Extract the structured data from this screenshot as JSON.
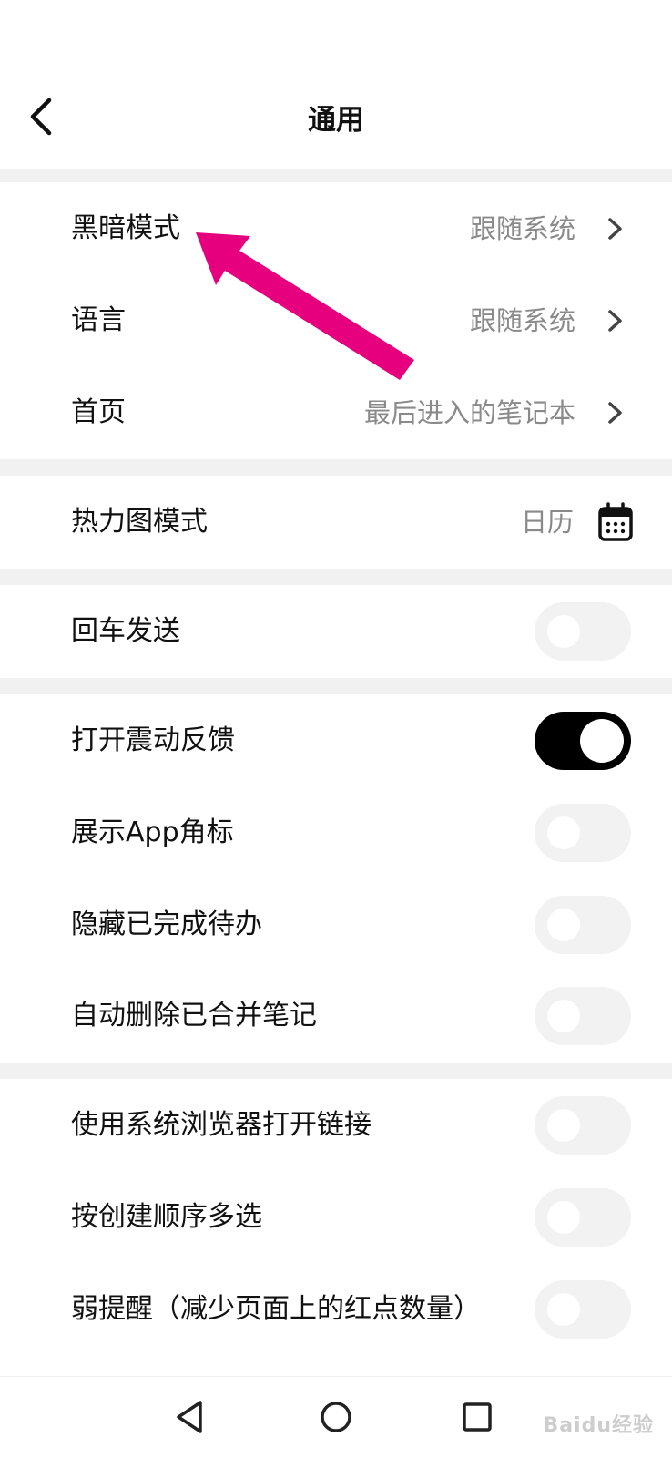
{
  "header": {
    "title": "通用"
  },
  "sections": [
    {
      "items": [
        {
          "label": "黑暗模式",
          "value": "跟随系统"
        },
        {
          "label": "语言",
          "value": "跟随系统"
        },
        {
          "label": "首页",
          "value": "最后进入的笔记本"
        }
      ]
    },
    {
      "items": [
        {
          "label": "热力图模式",
          "value": "日历"
        }
      ]
    },
    {
      "items": [
        {
          "label": "回车发送",
          "toggle": false
        }
      ]
    },
    {
      "items": [
        {
          "label": "打开震动反馈",
          "toggle": true
        },
        {
          "label": "展示App角标",
          "toggle": false
        },
        {
          "label": "隐藏已完成待办",
          "toggle": false
        },
        {
          "label": "自动删除已合并笔记",
          "toggle": false
        }
      ]
    },
    {
      "items": [
        {
          "label": "使用系统浏览器打开链接",
          "toggle": false
        },
        {
          "label": "按创建顺序多选",
          "toggle": false
        },
        {
          "label": "弱提醒（减少页面上的红点数量）",
          "toggle": false
        }
      ]
    }
  ],
  "watermark": "Baidu经验",
  "colors": {
    "accent_arrow": "#e6007e",
    "toggle_on": "#000000",
    "toggle_off": "#f2f2f2",
    "separator": "#f1f1f1",
    "value_text": "#8a8a8a"
  },
  "icons": {
    "back": "chevron-left-icon",
    "chevron": "chevron-right-icon",
    "calendar": "calendar-icon",
    "nav_back": "triangle-back-icon",
    "nav_home": "circle-home-icon",
    "nav_recents": "square-recents-icon"
  }
}
